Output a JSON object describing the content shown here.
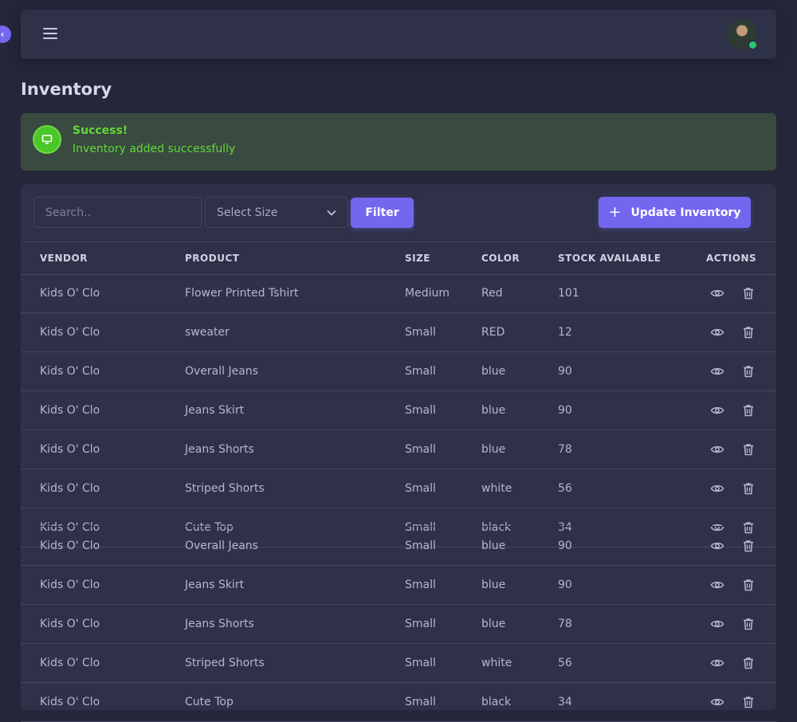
{
  "navbar": {
    "avatar_alt": "User avatar"
  },
  "page": {
    "title": "Inventory"
  },
  "alert": {
    "title": "Success!",
    "message": "Inventory added successfully"
  },
  "toolbar": {
    "search_placeholder": "Search..",
    "size_select": "Select Size",
    "filter_label": "Filter",
    "update_label": "Update Inventory"
  },
  "table": {
    "headers": [
      "VENDOR",
      "PRODUCT",
      "SIZE",
      "COLOR",
      "STOCK AVAILABLE",
      "ACTIONS"
    ],
    "rows": [
      [
        "Kids O' Clo",
        "Flower Printed Tshirt",
        "Medium",
        "Red",
        "101"
      ],
      [
        "Kids O' Clo",
        "sweater",
        "Small",
        "RED",
        "12"
      ],
      [
        "Kids O' Clo",
        "Overall Jeans",
        "Small",
        "blue",
        "90"
      ],
      [
        "Kids O' Clo",
        "Jeans Skirt",
        "Small",
        "blue",
        "90"
      ],
      [
        "Kids O' Clo",
        "Jeans Shorts",
        "Small",
        "blue",
        "78"
      ],
      [
        "Kids O' Clo",
        "Striped Shorts",
        "Small",
        "white",
        "56"
      ],
      [
        "Kids O' Clo",
        "Cute Top",
        "Small",
        "black",
        "34"
      ],
      [
        "Kids O' Clo",
        "Overall Jeans",
        "Small",
        "blue",
        "90"
      ],
      [
        "Kids O' Clo",
        "Jeans Skirt",
        "Small",
        "blue",
        "90"
      ],
      [
        "Kids O' Clo",
        "Jeans Shorts",
        "Small",
        "blue",
        "78"
      ],
      [
        "Kids O' Clo",
        "Striped Shorts",
        "Small",
        "white",
        "56"
      ],
      [
        "Kids O' Clo",
        "Cute Top",
        "Small",
        "black",
        "34"
      ]
    ]
  },
  "colors": {
    "accent": "#7367f0",
    "success": "#62d83a",
    "background": "#25263a",
    "card": "#2f3149"
  }
}
